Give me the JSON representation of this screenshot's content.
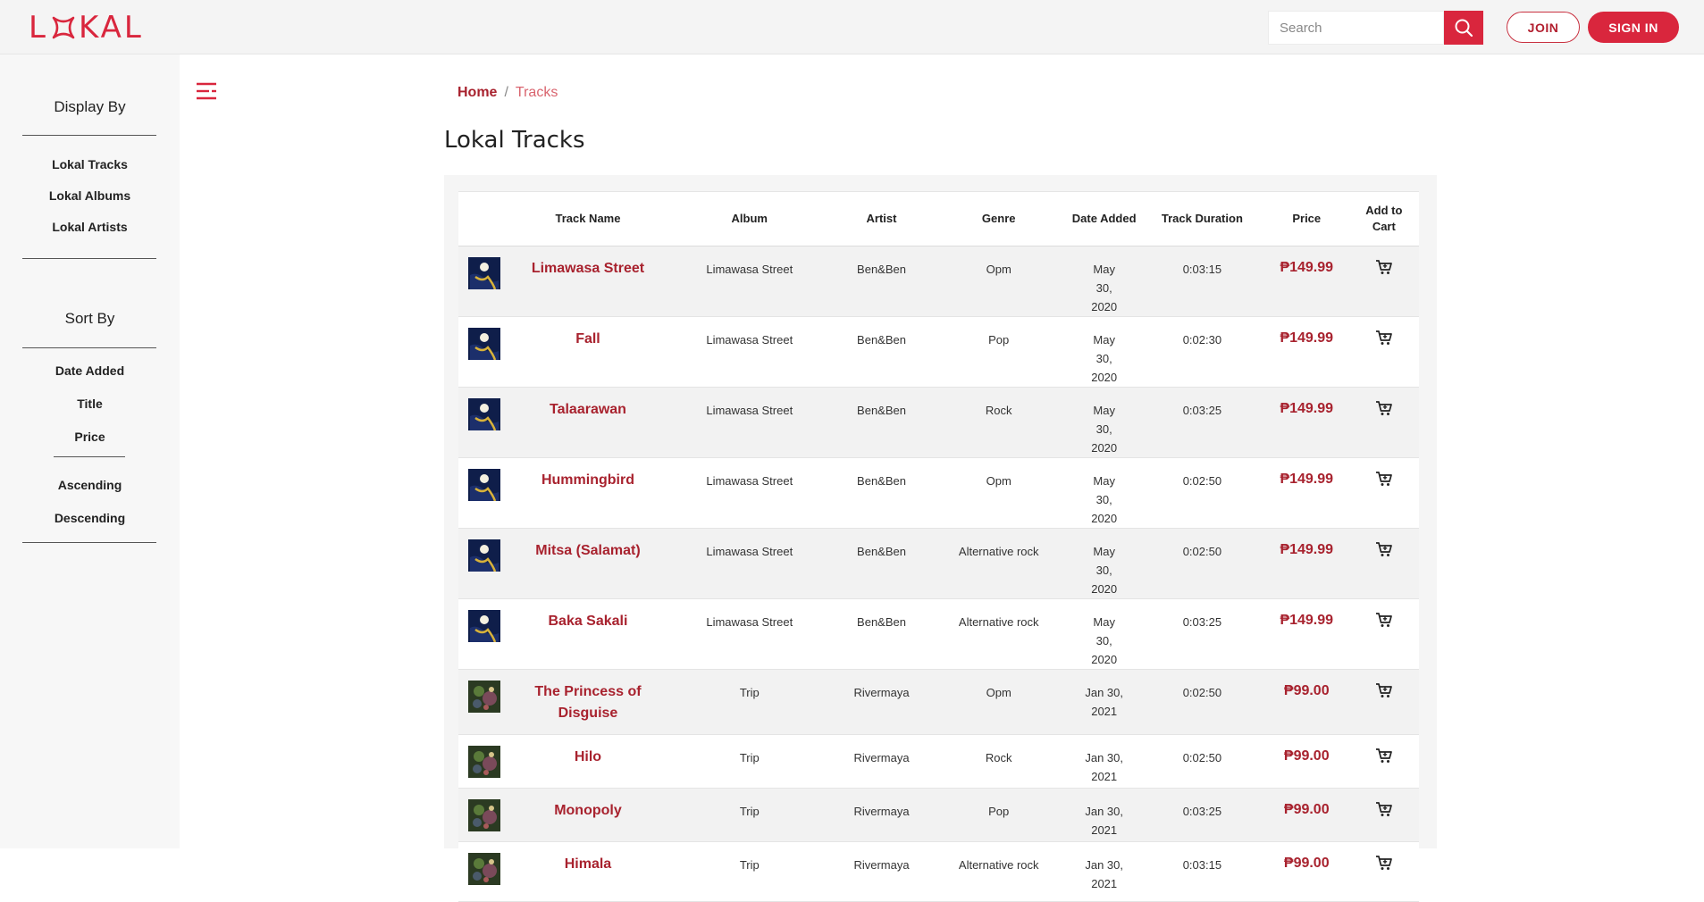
{
  "header": {
    "logo_text_left": "L",
    "logo_text_right": "KAL",
    "search_placeholder": "Search",
    "join_label": "JOIN",
    "signin_label": "SIGN IN"
  },
  "sidebar": {
    "display_title": "Display By",
    "display_items": [
      "Lokal Tracks",
      "Lokal Albums",
      "Lokal Artists"
    ],
    "sort_title": "Sort By",
    "sort_items": [
      "Date Added",
      "Title",
      "Price"
    ],
    "order_items": [
      "Ascending",
      "Descending"
    ]
  },
  "breadcrumb": {
    "home": "Home",
    "separator": "/",
    "current": "Tracks"
  },
  "page_title": "Lokal Tracks",
  "table": {
    "headers": [
      "",
      "Track Name",
      "Album",
      "Artist",
      "Genre",
      "Date Added",
      "Track Duration",
      "Price",
      "Add to Cart"
    ],
    "rows": [
      {
        "name": "Limawasa Street",
        "album": "Limawasa Street",
        "artist": "Ben&Ben",
        "genre": "Opm",
        "date": "May 30, 2020",
        "duration": "0:03:15",
        "price": "₱149.99",
        "cover": "ben"
      },
      {
        "name": "Fall",
        "album": "Limawasa Street",
        "artist": "Ben&Ben",
        "genre": "Pop",
        "date": "May 30, 2020",
        "duration": "0:02:30",
        "price": "₱149.99",
        "cover": "ben"
      },
      {
        "name": "Talaarawan",
        "album": "Limawasa Street",
        "artist": "Ben&Ben",
        "genre": "Rock",
        "date": "May 30, 2020",
        "duration": "0:03:25",
        "price": "₱149.99",
        "cover": "ben"
      },
      {
        "name": "Hummingbird",
        "album": "Limawasa Street",
        "artist": "Ben&Ben",
        "genre": "Opm",
        "date": "May 30, 2020",
        "duration": "0:02:50",
        "price": "₱149.99",
        "cover": "ben"
      },
      {
        "name": "Mitsa (Salamat)",
        "album": "Limawasa Street",
        "artist": "Ben&Ben",
        "genre": "Alternative rock",
        "date": "May 30, 2020",
        "duration": "0:02:50",
        "price": "₱149.99",
        "cover": "ben"
      },
      {
        "name": "Baka Sakali",
        "album": "Limawasa Street",
        "artist": "Ben&Ben",
        "genre": "Alternative rock",
        "date": "May 30, 2020",
        "duration": "0:03:25",
        "price": "₱149.99",
        "cover": "ben"
      },
      {
        "name": "The Princess of Disguise",
        "album": "Trip",
        "artist": "Rivermaya",
        "genre": "Opm",
        "date": "Jan 30, 2021",
        "duration": "0:02:50",
        "price": "₱99.00",
        "cover": "trip"
      },
      {
        "name": "Hilo",
        "album": "Trip",
        "artist": "Rivermaya",
        "genre": "Rock",
        "date": "Jan 30, 2021",
        "duration": "0:02:50",
        "price": "₱99.00",
        "cover": "trip"
      },
      {
        "name": "Monopoly",
        "album": "Trip",
        "artist": "Rivermaya",
        "genre": "Pop",
        "date": "Jan 30, 2021",
        "duration": "0:03:25",
        "price": "₱99.00",
        "cover": "trip"
      },
      {
        "name": "Himala",
        "album": "Trip",
        "artist": "Rivermaya",
        "genre": "Alternative rock",
        "date": "Jan 30, 2021",
        "duration": "0:03:15",
        "price": "₱99.00",
        "cover": "trip"
      }
    ]
  },
  "colors": {
    "brand": "#d9263d",
    "link": "#a8222e",
    "sidebar_bg": "#f7f7f7"
  }
}
